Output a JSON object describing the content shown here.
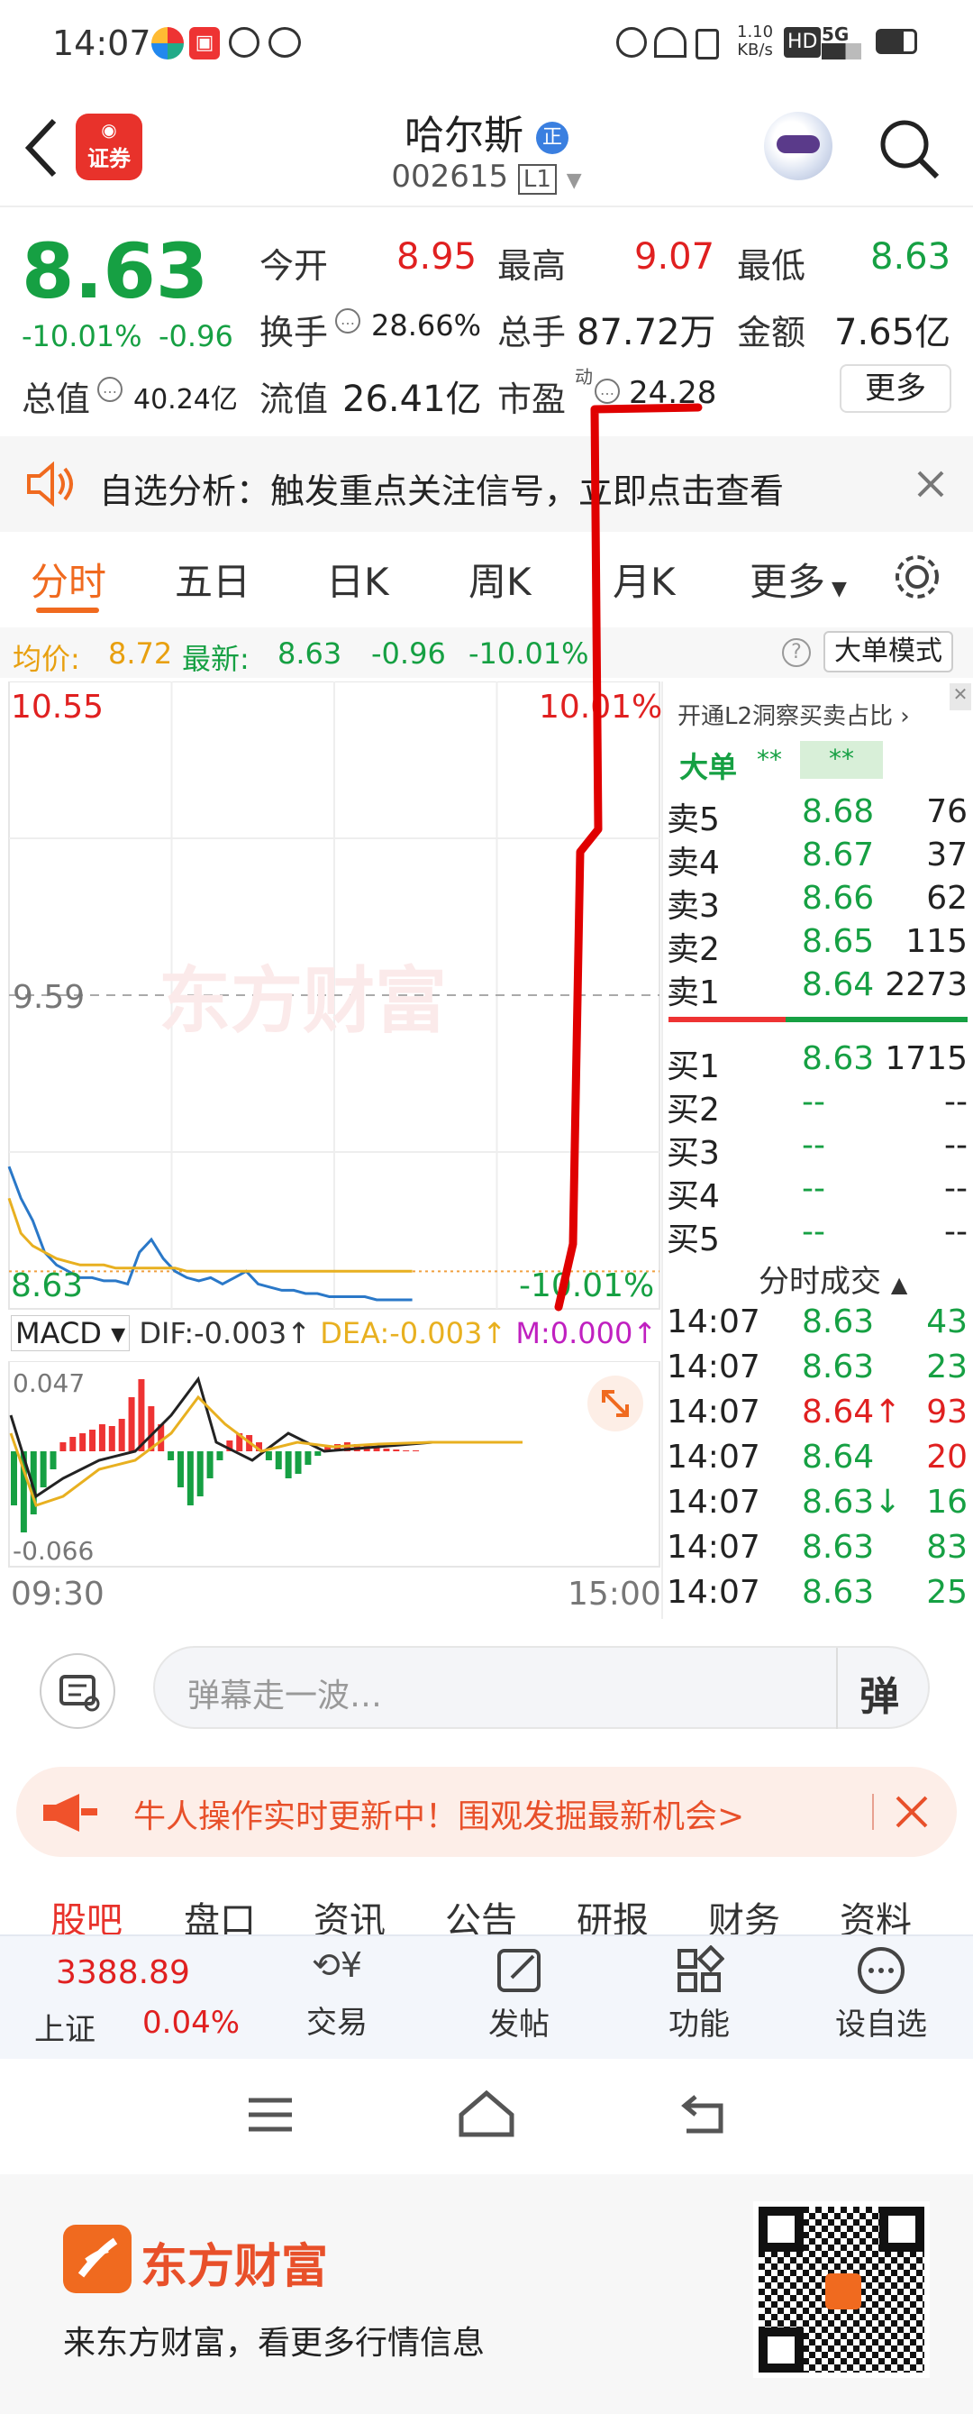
{
  "status_bar": {
    "time": "14:07",
    "speed_value": "1.10",
    "speed_unit": "KB/s",
    "hd": "HD",
    "net": "5G"
  },
  "header": {
    "brand_badge": "证券",
    "stock_name": "哈尔斯",
    "code": "002615",
    "level": "L1"
  },
  "quote": {
    "price": "8.63",
    "change_pct": "-10.01%",
    "change": "-0.96",
    "open_label": "今开",
    "open": "8.95",
    "high_label": "最高",
    "high": "9.07",
    "low_label": "最低",
    "low": "8.63",
    "turnover_label": "换手",
    "turnover": "28.66%",
    "volume_label": "总手",
    "volume": "87.72万",
    "amount_label": "金额",
    "amount": "7.65亿",
    "total_cap_label": "总值",
    "total_cap": "40.24亿",
    "float_cap_label": "流值",
    "float_cap": "26.41亿",
    "pe_label": "市盈",
    "pe_sup": "动",
    "pe": "24.28",
    "more_label": "更多"
  },
  "notice": {
    "text": "自选分析：触发重点关注信号，立即点击查看"
  },
  "tabs": [
    "分时",
    "五日",
    "日K",
    "周K",
    "月K",
    "更多"
  ],
  "summary": {
    "avg_label": "均价:",
    "avg": "8.72",
    "last_label": "最新:",
    "last": "8.63",
    "chg": "-0.96",
    "pct": "-10.01%",
    "big_order_mode": "大单模式"
  },
  "chart": {
    "y_top": "10.55",
    "y_top_pct": "10.01%",
    "y_mid": "9.59",
    "y_bottom": "8.63",
    "y_bottom_pct": "-10.01%",
    "watermark": "东方财富",
    "macd_label": "MACD",
    "dif": "DIF:-0.003↑",
    "dea": "DEA:-0.003↑",
    "m": "M:0.000↑",
    "macd_top": "0.047",
    "macd_bottom": "-0.066",
    "time_start": "09:30",
    "time_end": "15:00"
  },
  "chart_data": {
    "type": "line",
    "series": [
      {
        "name": "price",
        "values": [
          9.05,
          8.95,
          8.88,
          8.78,
          8.74,
          8.72,
          8.7,
          8.7,
          8.69,
          8.69,
          8.68,
          8.78,
          8.82,
          8.76,
          8.72,
          8.7,
          8.69,
          8.7,
          8.68,
          8.7,
          8.72,
          8.68,
          8.67,
          8.66,
          8.66,
          8.65,
          8.65,
          8.64,
          8.64,
          8.64,
          8.64,
          8.63,
          8.63,
          8.63,
          8.63
        ]
      },
      {
        "name": "average",
        "values": [
          8.95,
          8.84,
          8.8,
          8.78,
          8.76,
          8.75,
          8.74,
          8.74,
          8.74,
          8.73,
          8.73,
          8.73,
          8.73,
          8.73,
          8.73,
          8.72,
          8.72,
          8.72,
          8.72,
          8.72,
          8.72,
          8.72,
          8.72,
          8.72,
          8.72,
          8.72,
          8.72,
          8.72,
          8.72,
          8.72,
          8.72,
          8.72,
          8.72,
          8.72,
          8.72
        ]
      }
    ],
    "ylim": [
      8.63,
      10.55
    ]
  },
  "orderbook": {
    "l2_link": "开通L2洞察买卖占比",
    "big_label": "大单",
    "big_v1": "**",
    "big_v2": "**",
    "sells": [
      {
        "label": "卖5",
        "price": "8.68",
        "vol": "76"
      },
      {
        "label": "卖4",
        "price": "8.67",
        "vol": "37"
      },
      {
        "label": "卖3",
        "price": "8.66",
        "vol": "62"
      },
      {
        "label": "卖2",
        "price": "8.65",
        "vol": "115"
      },
      {
        "label": "卖1",
        "price": "8.64",
        "vol": "2273"
      }
    ],
    "buys": [
      {
        "label": "买1",
        "price": "8.63",
        "vol": "1715"
      },
      {
        "label": "买2",
        "price": "--",
        "vol": "--"
      },
      {
        "label": "买3",
        "price": "--",
        "vol": "--"
      },
      {
        "label": "买4",
        "price": "--",
        "vol": "--"
      },
      {
        "label": "买5",
        "price": "--",
        "vol": "--"
      }
    ],
    "trades_label": "分时成交",
    "trades": [
      {
        "time": "14:07",
        "price": "8.63",
        "vol": "43"
      },
      {
        "time": "14:07",
        "price": "8.63",
        "vol": "23"
      },
      {
        "time": "14:07",
        "price": "8.64↑",
        "vol": "93"
      },
      {
        "time": "14:07",
        "price": "8.64",
        "vol": "20"
      },
      {
        "time": "14:07",
        "price": "8.63↓",
        "vol": "16"
      },
      {
        "time": "14:07",
        "price": "8.63",
        "vol": "83"
      },
      {
        "time": "14:07",
        "price": "8.63",
        "vol": "25"
      }
    ]
  },
  "danmu": {
    "placeholder": "弹幕走一波…",
    "button": "弹"
  },
  "promo": {
    "text": "牛人操作实时更新中！围观发掘最新机会>"
  },
  "bottom_tabs": [
    "股吧",
    "盘口",
    "资讯",
    "公告",
    "研报",
    "财务",
    "资料"
  ],
  "dock": {
    "index_value": "3388.89",
    "index_name": "上证",
    "index_pct": "0.04%",
    "trade": "交易",
    "post": "发帖",
    "func": "功能",
    "watch": "设自选"
  },
  "footer": {
    "brand": "东方财富",
    "slogan": "来东方财富，看更多行情信息"
  },
  "colors": {
    "red": "#e02020",
    "green": "#16a043",
    "orange": "#f06a1f",
    "avg_line": "#e8b020",
    "price_line": "#2a78c8"
  }
}
